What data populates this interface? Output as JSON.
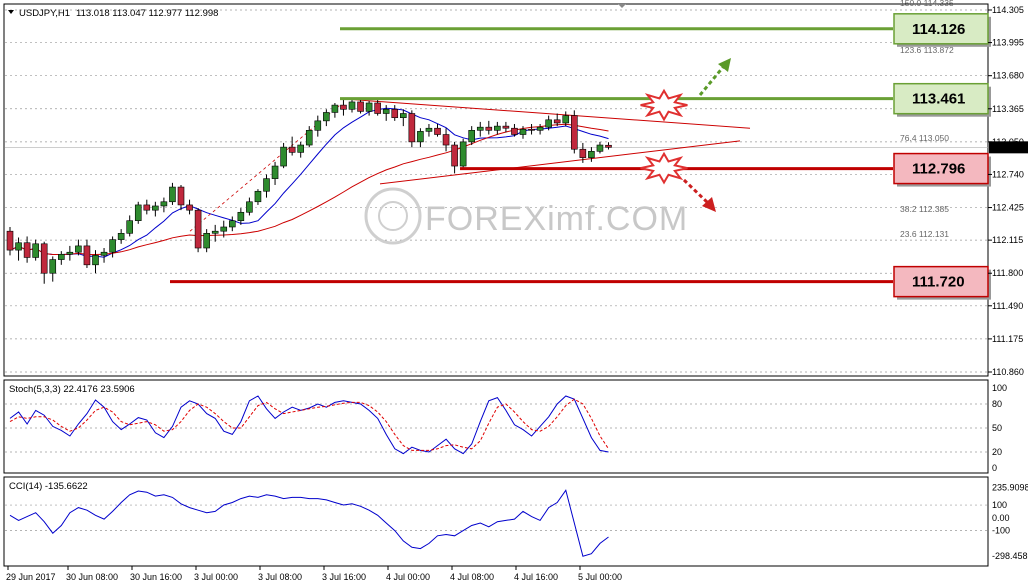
{
  "chart_data": [
    {
      "type": "candlestick",
      "panel": "main",
      "symbol_label": "USDJPY,H1",
      "ohlc_label": "113.018 113.047 112.977 112.998",
      "current_price": "112.998",
      "ylim": [
        110.86,
        114.35
      ],
      "grid": "dotted horizontal",
      "y_tick_labels": [
        "114.305",
        "113.995",
        "113.680",
        "113.365",
        "113.050",
        "112.740",
        "112.425",
        "112.115",
        "111.800",
        "111.490",
        "111.175",
        "110.860"
      ],
      "x_tick_labels": [
        "29 Jun 2017",
        "30 Jun 08:00",
        "30 Jun 16:00",
        "3 Jul 00:00",
        "3 Jul 08:00",
        "3 Jul 16:00",
        "4 Jul 00:00",
        "4 Jul 08:00",
        "4 Jul 16:00",
        "5 Jul 00:00"
      ],
      "fibonacci_labels": [
        "150.0  114.335",
        "123.6  113.872",
        "76.4  113.050",
        "38.2  112.385",
        "23.6  112.131"
      ],
      "levels": [
        {
          "value": 114.126,
          "label": "114.126",
          "color": "#6aa035",
          "kind": "resistance"
        },
        {
          "value": 113.461,
          "label": "113.461",
          "color": "#6aa035",
          "kind": "resistance"
        },
        {
          "value": 112.796,
          "label": "112.796",
          "color": "#c00000",
          "kind": "support"
        },
        {
          "value": 111.72,
          "label": "111.720",
          "color": "#c00000",
          "kind": "support"
        }
      ],
      "candles": [
        [
          112.2,
          112.24,
          111.97,
          112.02
        ],
        [
          112.02,
          112.14,
          111.92,
          112.09
        ],
        [
          112.09,
          112.15,
          111.9,
          111.95
        ],
        [
          111.95,
          112.12,
          111.92,
          112.08
        ],
        [
          112.08,
          112.1,
          111.7,
          111.8
        ],
        [
          111.8,
          111.96,
          111.72,
          111.93
        ],
        [
          111.93,
          112.01,
          111.88,
          111.98
        ],
        [
          111.98,
          112.06,
          111.92,
          112.0
        ],
        [
          112.0,
          112.12,
          111.97,
          112.06
        ],
        [
          112.06,
          112.12,
          111.85,
          111.88
        ],
        [
          111.88,
          112.02,
          111.8,
          111.97
        ],
        [
          111.97,
          112.04,
          111.9,
          112.0
        ],
        [
          112.0,
          112.15,
          111.95,
          112.12
        ],
        [
          112.12,
          112.22,
          112.08,
          112.18
        ],
        [
          112.18,
          112.35,
          112.15,
          112.3
        ],
        [
          112.3,
          112.48,
          112.27,
          112.45
        ],
        [
          112.45,
          112.5,
          112.36,
          112.4
        ],
        [
          112.4,
          112.48,
          112.34,
          112.44
        ],
        [
          112.44,
          112.52,
          112.38,
          112.48
        ],
        [
          112.48,
          112.66,
          112.45,
          112.62
        ],
        [
          112.62,
          112.64,
          112.4,
          112.45
        ],
        [
          112.45,
          112.5,
          112.36,
          112.4
        ],
        [
          112.4,
          112.42,
          112.0,
          112.04
        ],
        [
          112.04,
          112.22,
          112.0,
          112.18
        ],
        [
          112.18,
          112.26,
          112.1,
          112.2
        ],
        [
          112.2,
          112.3,
          112.14,
          112.24
        ],
        [
          112.24,
          112.34,
          112.2,
          112.3
        ],
        [
          112.3,
          112.42,
          112.26,
          112.38
        ],
        [
          112.38,
          112.52,
          112.35,
          112.48
        ],
        [
          112.48,
          112.6,
          112.45,
          112.58
        ],
        [
          112.58,
          112.74,
          112.52,
          112.7
        ],
        [
          112.7,
          112.86,
          112.64,
          112.82
        ],
        [
          112.82,
          113.04,
          112.8,
          113.0
        ],
        [
          113.0,
          113.1,
          112.92,
          112.95
        ],
        [
          112.95,
          113.05,
          112.9,
          113.02
        ],
        [
          113.02,
          113.2,
          113.0,
          113.16
        ],
        [
          113.16,
          113.3,
          113.1,
          113.25
        ],
        [
          113.25,
          113.36,
          113.2,
          113.33
        ],
        [
          113.33,
          113.42,
          113.28,
          113.4
        ],
        [
          113.4,
          113.45,
          113.3,
          113.36
        ],
        [
          113.36,
          113.46,
          113.33,
          113.43
        ],
        [
          113.43,
          113.46,
          113.32,
          113.34
        ],
        [
          113.34,
          113.44,
          113.3,
          113.42
        ],
        [
          113.42,
          113.45,
          113.3,
          113.32
        ],
        [
          113.32,
          113.4,
          113.25,
          113.36
        ],
        [
          113.36,
          113.4,
          113.25,
          113.28
        ],
        [
          113.28,
          113.36,
          113.2,
          113.32
        ],
        [
          113.32,
          113.35,
          113.0,
          113.05
        ],
        [
          113.05,
          113.18,
          113.0,
          113.15
        ],
        [
          113.15,
          113.22,
          113.1,
          113.18
        ],
        [
          113.18,
          113.22,
          113.1,
          113.12
        ],
        [
          113.12,
          113.18,
          112.96,
          113.02
        ],
        [
          113.02,
          113.05,
          112.75,
          112.82
        ],
        [
          112.82,
          113.08,
          112.8,
          113.05
        ],
        [
          113.05,
          113.2,
          113.02,
          113.16
        ],
        [
          113.16,
          113.24,
          113.1,
          113.19
        ],
        [
          113.19,
          113.25,
          113.12,
          113.16
        ],
        [
          113.16,
          113.24,
          113.12,
          113.2
        ],
        [
          113.2,
          113.24,
          113.14,
          113.18
        ],
        [
          113.18,
          113.22,
          113.1,
          113.12
        ],
        [
          113.12,
          113.2,
          113.08,
          113.17
        ],
        [
          113.17,
          113.22,
          113.12,
          113.16
        ],
        [
          113.16,
          113.22,
          113.12,
          113.19
        ],
        [
          113.19,
          113.3,
          113.16,
          113.26
        ],
        [
          113.26,
          113.32,
          113.2,
          113.23
        ],
        [
          113.23,
          113.34,
          113.2,
          113.3
        ],
        [
          113.3,
          113.35,
          112.94,
          112.98
        ],
        [
          112.98,
          113.04,
          112.85,
          112.9
        ],
        [
          112.9,
          113.0,
          112.86,
          112.96
        ],
        [
          112.96,
          113.05,
          112.94,
          113.02
        ],
        [
          113.018,
          113.047,
          112.977,
          112.998
        ]
      ]
    },
    {
      "type": "line",
      "panel": "stochastic",
      "label": "Stoch(5,3,3) 22.4176 23.5906",
      "ylim": [
        0,
        100
      ],
      "y_tick_labels": [
        "100",
        "80",
        "50",
        "20",
        "0"
      ],
      "series": [
        {
          "color": "#0000cc",
          "values": [
            62,
            70,
            55,
            72,
            66,
            52,
            47,
            40,
            55,
            68,
            85,
            76,
            58,
            48,
            55,
            63,
            60,
            44,
            38,
            52,
            76,
            84,
            80,
            68,
            62,
            46,
            42,
            58,
            84,
            90,
            74,
            62,
            70,
            76,
            72,
            75,
            80,
            76,
            82,
            84,
            82,
            80,
            72,
            62,
            42,
            24,
            18,
            26,
            22,
            20,
            28,
            36,
            24,
            18,
            30,
            58,
            84,
            88,
            72,
            54,
            48,
            40,
            52,
            64,
            80,
            90,
            86,
            62,
            38,
            22,
            20
          ]
        },
        {
          "color": "#e00000",
          "values": [
            58,
            64,
            62,
            64,
            64,
            60,
            52,
            46,
            50,
            60,
            72,
            76,
            70,
            58,
            54,
            56,
            58,
            54,
            46,
            48,
            58,
            72,
            80,
            76,
            68,
            58,
            50,
            50,
            64,
            78,
            82,
            74,
            68,
            70,
            72,
            74,
            76,
            77,
            79,
            81,
            82,
            82,
            78,
            70,
            58,
            42,
            28,
            22,
            22,
            22,
            24,
            28,
            29,
            26,
            24,
            34,
            56,
            76,
            80,
            70,
            58,
            48,
            46,
            52,
            64,
            78,
            86,
            80,
            62,
            40,
            24
          ]
        }
      ]
    },
    {
      "type": "line",
      "panel": "cci",
      "label": "CCI(14) -135.6622",
      "ylim": [
        -345,
        280
      ],
      "y_tick_labels": [
        "235.9098",
        "100",
        "0.00",
        "-100",
        "-298.4589"
      ],
      "series": [
        {
          "name": "CCI(14)",
          "color": "#0000cc",
          "values": [
            20,
            -20,
            10,
            40,
            -30,
            -120,
            -60,
            40,
            80,
            60,
            20,
            -10,
            50,
            120,
            180,
            210,
            200,
            170,
            180,
            160,
            110,
            80,
            60,
            40,
            50,
            100,
            120,
            150,
            170,
            160,
            180,
            170,
            150,
            160,
            160,
            150,
            150,
            140,
            120,
            100,
            110,
            90,
            60,
            20,
            -40,
            -100,
            -180,
            -230,
            -240,
            -200,
            -140,
            -130,
            -140,
            -100,
            -60,
            -40,
            -70,
            -30,
            -20,
            -10,
            50,
            10,
            -20,
            80,
            120,
            215,
            -40,
            -300,
            -280,
            -200,
            -150
          ]
        }
      ]
    }
  ],
  "watermark": "FOREXimf.COM"
}
